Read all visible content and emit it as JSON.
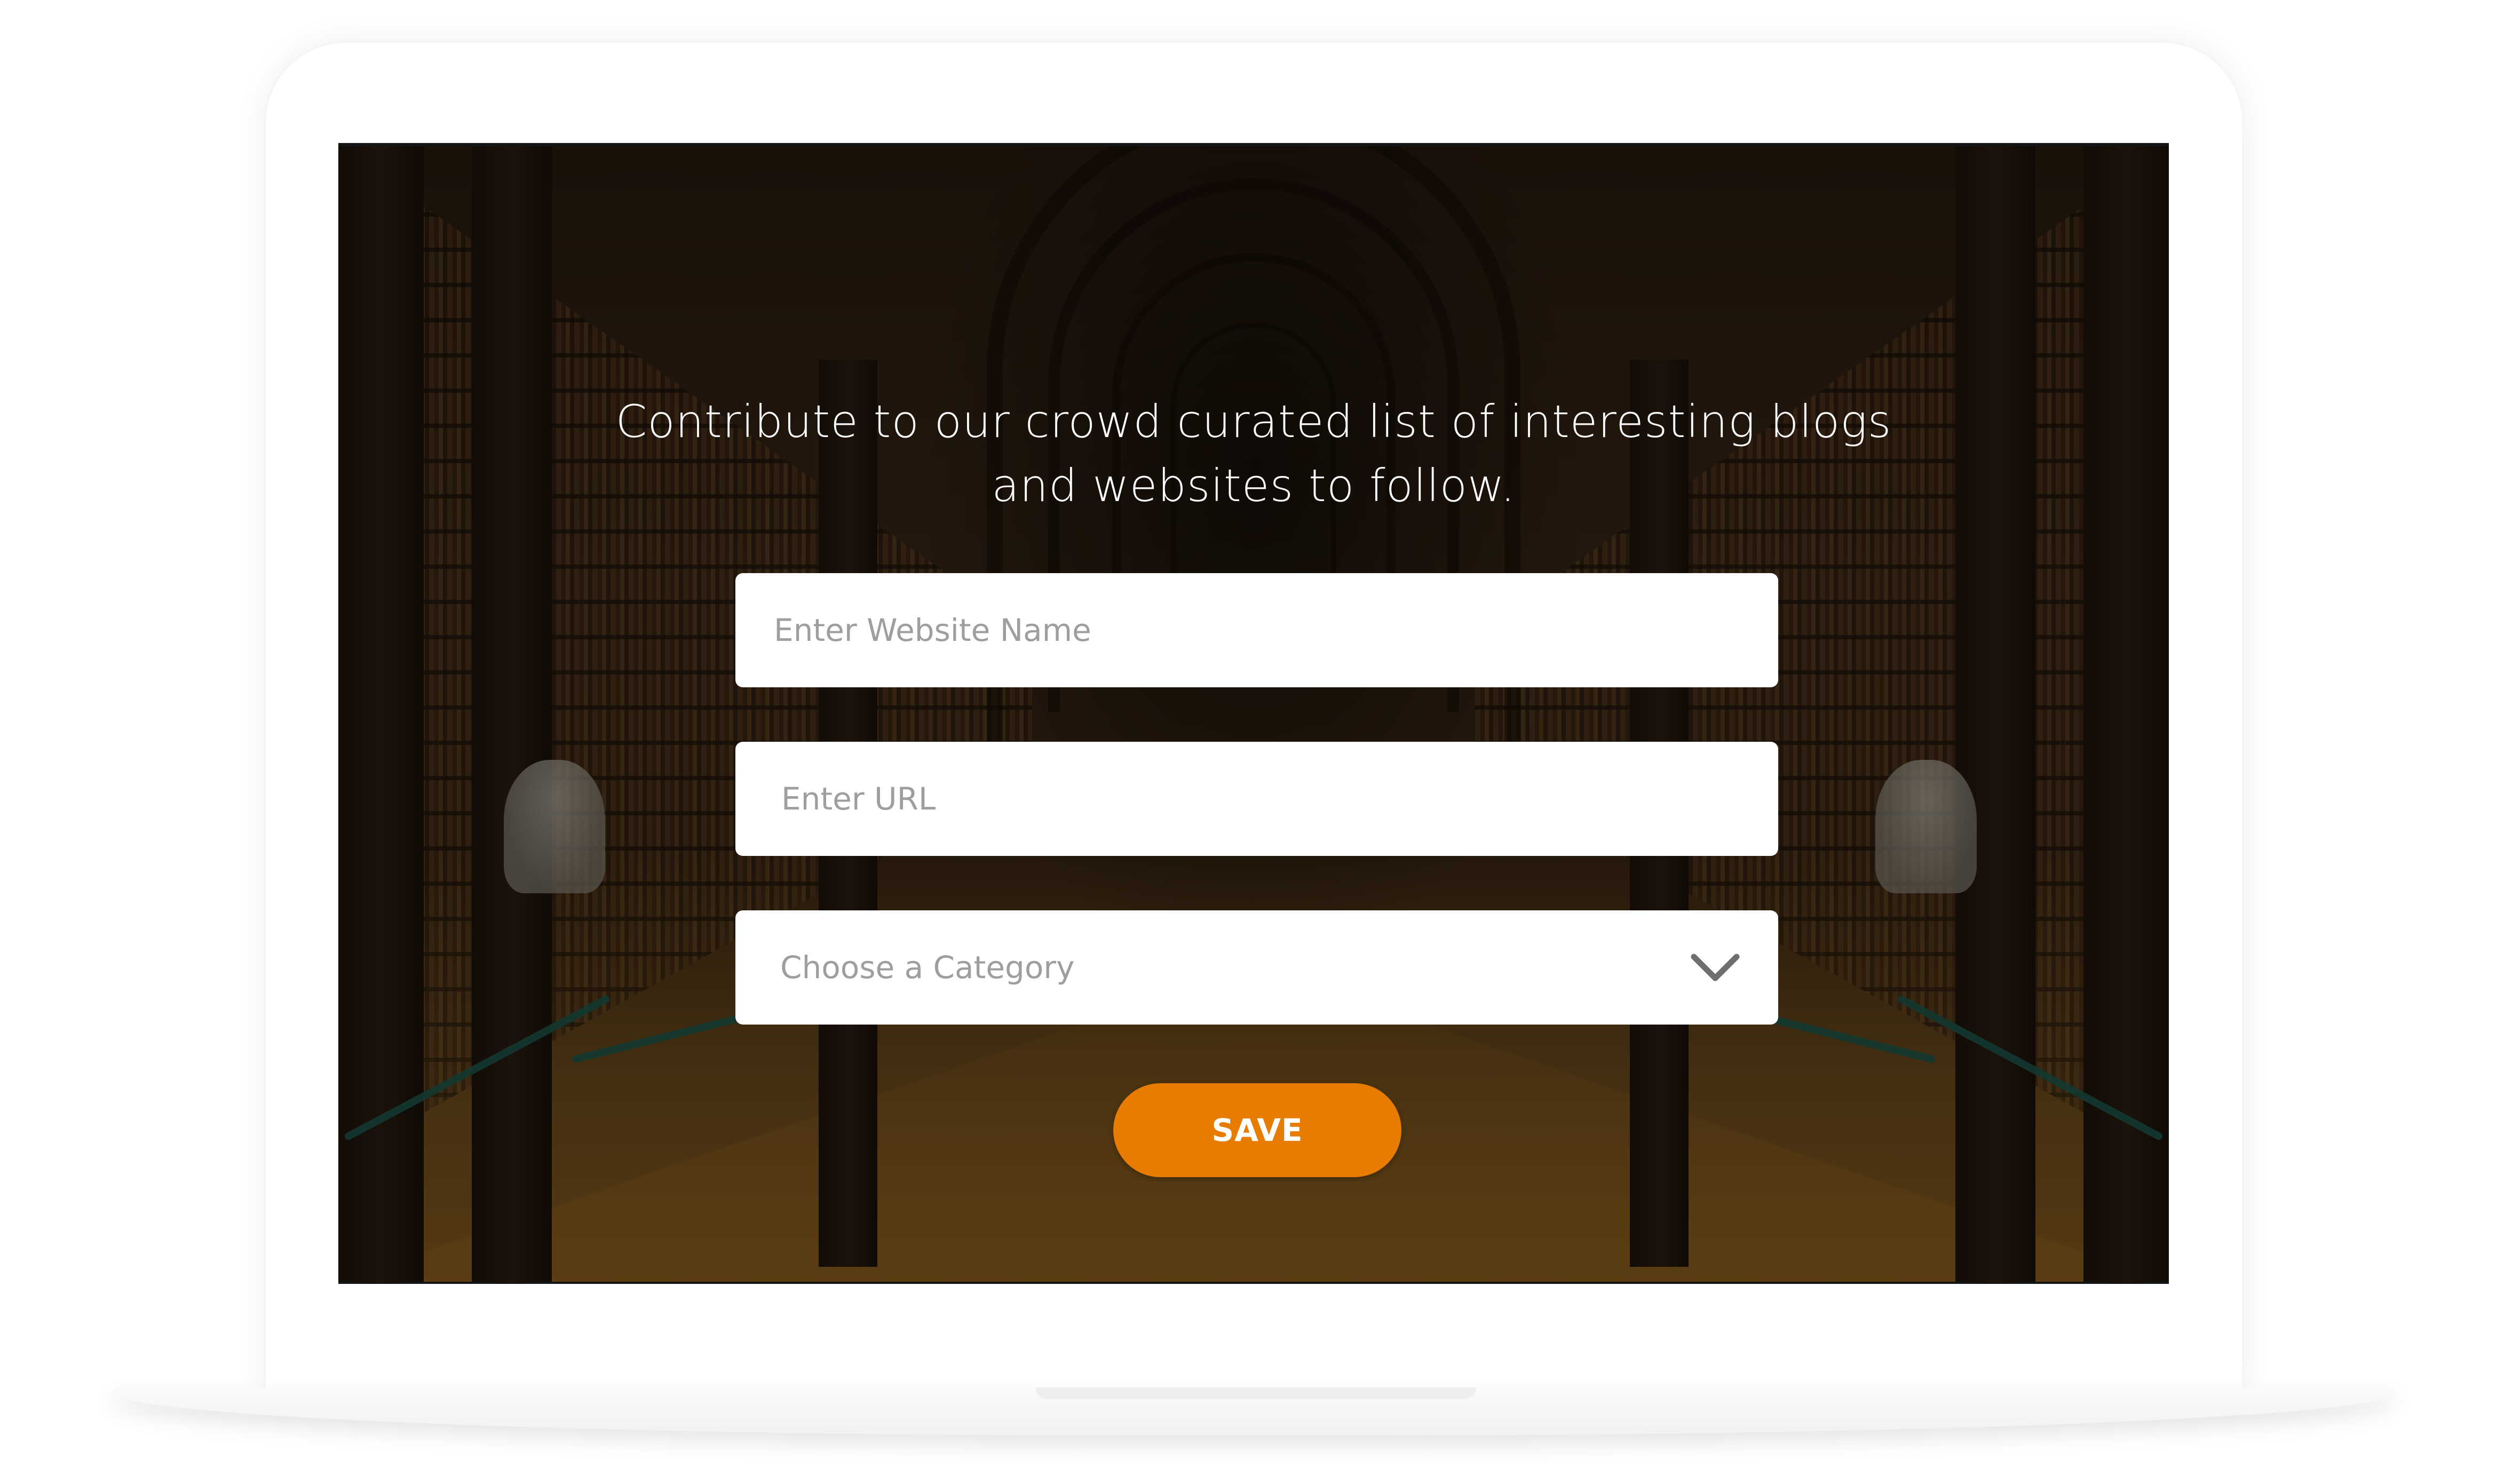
{
  "form": {
    "headline_line1": "Contribute to our crowd curated list of interesting blogs",
    "headline_line2": "and websites to follow.",
    "website_name_placeholder": "Enter Website Name",
    "website_name_value": "",
    "url_placeholder": "Enter URL",
    "url_value": "",
    "category_selected": "Choose a Category",
    "save_label": "SAVE"
  },
  "colors": {
    "accent": "#e77c00",
    "field_background": "#ffffff",
    "placeholder_text": "#9e9e9e",
    "headline_text": "#ffffff"
  },
  "icons": {
    "category_dropdown": "chevron-down-icon"
  }
}
